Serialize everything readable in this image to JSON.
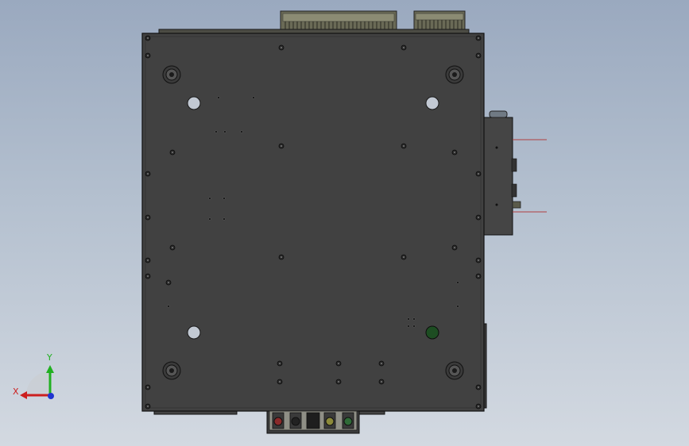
{
  "viewport": {
    "background_top": "#9aa9bf",
    "background_bottom": "#d3d9e1"
  },
  "model": {
    "plate_color": "#414141",
    "edge_color": "#111111",
    "connector_color": "#5a5a4a",
    "green_part": "#1d4d22",
    "red_wire": "#b04040"
  },
  "triad": {
    "x_label": "X",
    "y_label": "Y",
    "x_color": "#cc1f1f",
    "y_color": "#21b021",
    "z_color": "#2035d0"
  }
}
